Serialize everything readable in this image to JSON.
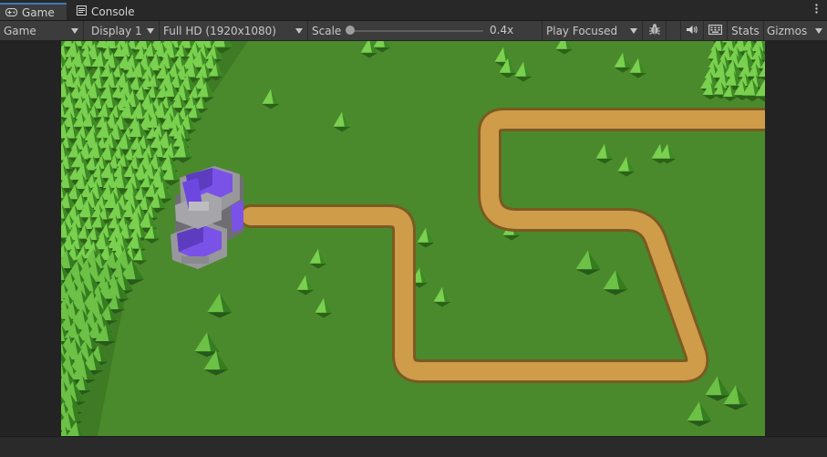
{
  "tabs": [
    {
      "label": "Game",
      "icon": "gamepad-icon",
      "active": true
    },
    {
      "label": "Console",
      "icon": "console-icon",
      "active": false
    }
  ],
  "more_menu_icon": "kebab-menu-icon",
  "toolbar": {
    "view_mode": "Game",
    "display": "Display 1",
    "resolution": "Full HD (1920x1080)",
    "scale_label": "Scale",
    "scale_value": "0.4x",
    "scale_level": 0.0,
    "play_mode": "Play Focused",
    "debug_icon": "bug-icon",
    "audio_icon": "speaker-icon",
    "keyboard_icon": "keyboard-icon",
    "stats_label": "Stats",
    "gizmos_label": "Gizmos"
  },
  "colors": {
    "accent": "#3a79bb",
    "grass": "#4a8a2c",
    "path": "#cc9a48",
    "path_edge": "#8a6a2a",
    "tree_light": "#72c24a",
    "tree_dark": "#2f6b1c",
    "castle_roof": "#7b52e8",
    "castle_stone": "#8f8f93"
  }
}
